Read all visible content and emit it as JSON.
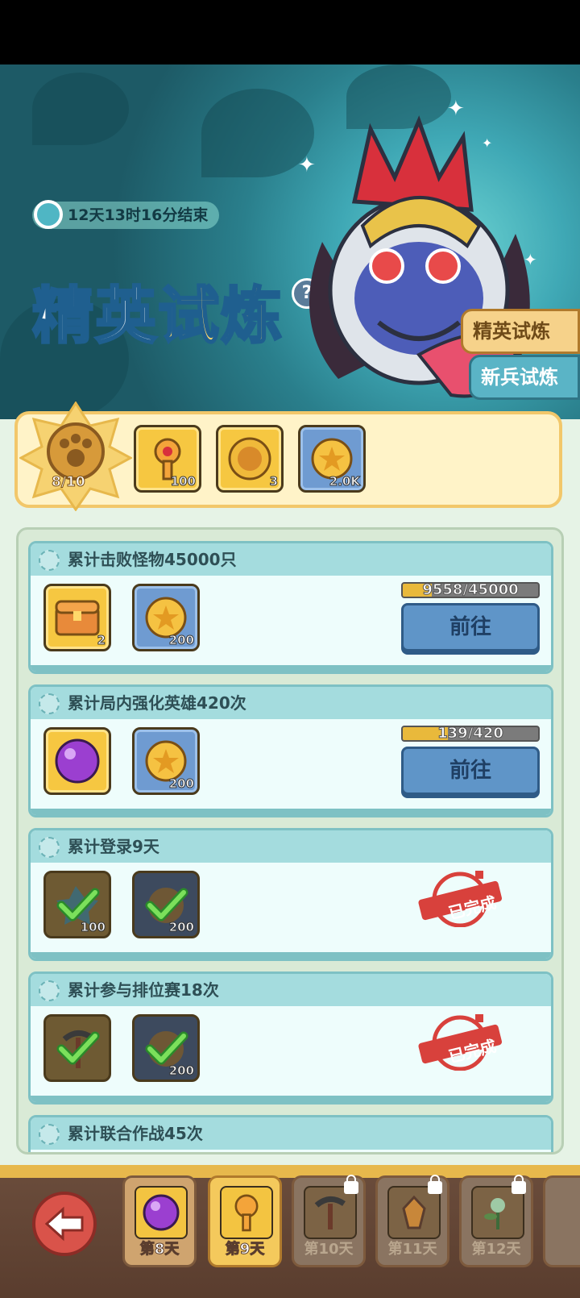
{
  "banner": {
    "timer": "12天13时16分结束",
    "title_part1": "精英",
    "title_part2": "试炼",
    "help": "?",
    "tabs": [
      "精英试炼",
      "新兵试炼"
    ]
  },
  "reward_bar": {
    "medal_progress": "8/10",
    "items": [
      {
        "icon": "golden-key-icon",
        "count": "100"
      },
      {
        "icon": "gold-emblem-icon",
        "count": "3"
      },
      {
        "icon": "gold-coin-icon",
        "count": "2.0K"
      }
    ]
  },
  "tasks": [
    {
      "title": "累计击败怪物45000只",
      "rewards": [
        {
          "icon": "treasure-chest-icon",
          "count": "2"
        },
        {
          "icon": "gold-coin-icon",
          "count": "200"
        }
      ],
      "progress_text": "9558/45000",
      "progress": 0.212,
      "button": "前往"
    },
    {
      "title": "累计局内强化英雄420次",
      "rewards": [
        {
          "icon": "purple-orb-icon",
          "count": ""
        },
        {
          "icon": "gold-coin-icon",
          "count": "200"
        }
      ],
      "progress_text": "139/420",
      "progress": 0.331,
      "button": "前往"
    },
    {
      "title": "累计登录9天",
      "rewards": [
        {
          "icon": "blue-crystal-icon",
          "count": "100"
        },
        {
          "icon": "gold-coin-icon",
          "count": "200"
        }
      ],
      "stamp": "已完成"
    },
    {
      "title": "累计参与排位赛18次",
      "rewards": [
        {
          "icon": "pickaxe-icon",
          "count": ""
        },
        {
          "icon": "gold-coin-icon",
          "count": "200"
        }
      ],
      "stamp": "已完成"
    },
    {
      "title": "累计联合作战45次"
    }
  ],
  "days": [
    {
      "label": "第8天",
      "state": "normal",
      "icon": "purple-orb-icon"
    },
    {
      "label": "第9天",
      "state": "selected",
      "icon": "golden-key-icon"
    },
    {
      "label": "第10天",
      "state": "locked",
      "icon": "pickaxe-icon"
    },
    {
      "label": "第11天",
      "state": "locked",
      "icon": "crystal-icon"
    },
    {
      "label": "第12天",
      "state": "locked",
      "icon": "plant-icon"
    }
  ]
}
